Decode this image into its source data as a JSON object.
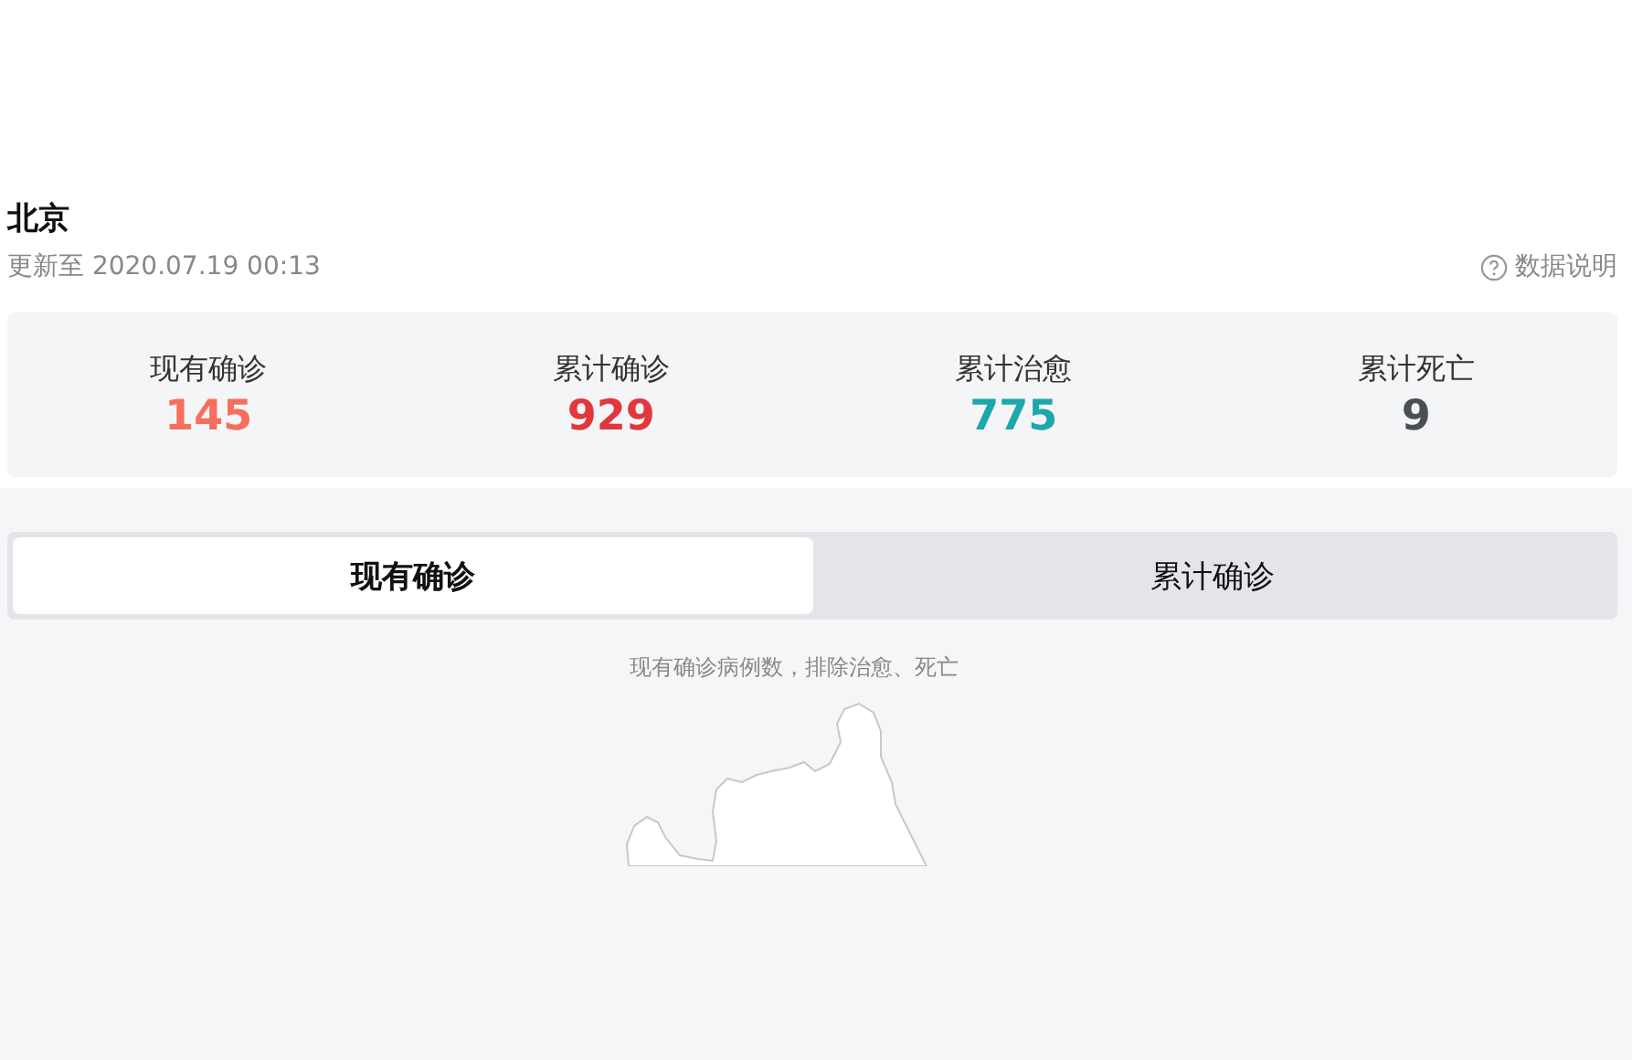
{
  "region": {
    "title": "北京",
    "updated": "更新至 2020.07.19 00:13",
    "help_link": "数据说明"
  },
  "stats": [
    {
      "label": "现有确诊",
      "value": "145",
      "color": "#f76e5c"
    },
    {
      "label": "累计确诊",
      "value": "929",
      "color": "#e2373c"
    },
    {
      "label": "累计治愈",
      "value": "775",
      "color": "#1ba7ab"
    },
    {
      "label": "累计死亡",
      "value": "9",
      "color": "#4b4f55"
    }
  ],
  "tabs": [
    {
      "label": "现有确诊",
      "selected": true
    },
    {
      "label": "累计确诊",
      "selected": false
    }
  ],
  "map": {
    "note": "现有确诊病例数，排除治愈、死亡"
  }
}
